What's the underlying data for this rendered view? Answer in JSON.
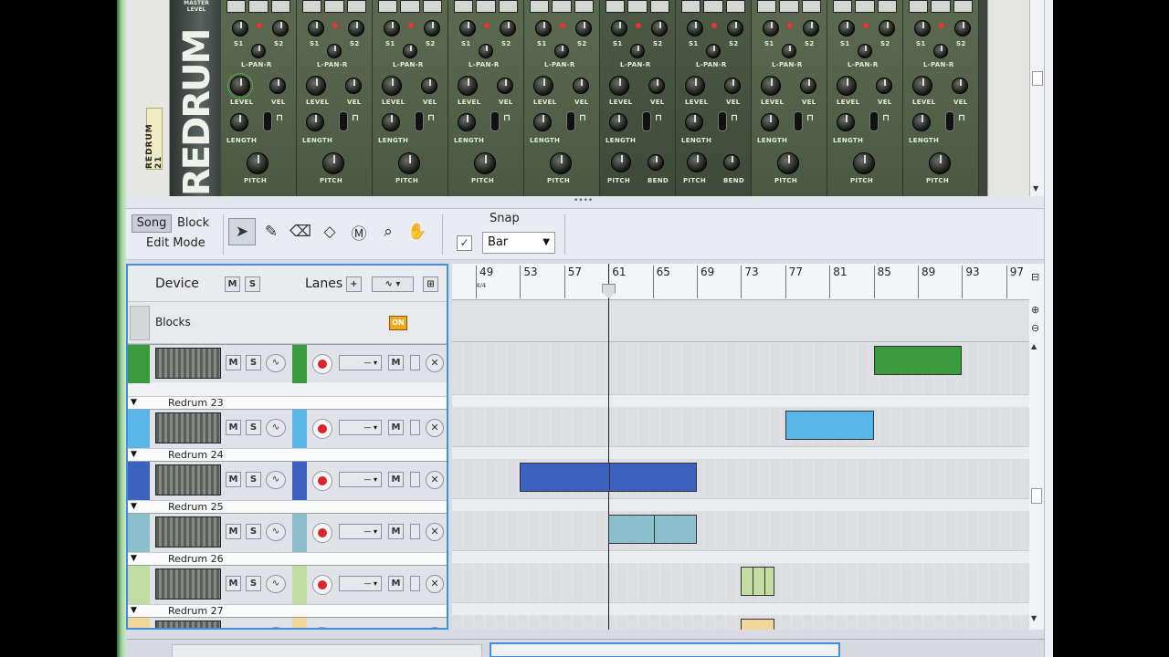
{
  "rack": {
    "device_label": "REDRUM 21",
    "brand_top": "MASTER LEVEL",
    "brand_logo": "REDRUM",
    "channels": [
      {
        "s1": "S1",
        "s2": "S2",
        "pan": "L-PAN-R",
        "level": "LEVEL",
        "vel": "VEL",
        "length": "LENGTH",
        "pitch": "PITCH",
        "bend": "",
        "dark": false
      },
      {
        "s1": "S1",
        "s2": "S2",
        "pan": "L-PAN-R",
        "level": "LEVEL",
        "vel": "VEL",
        "length": "LENGTH",
        "pitch": "PITCH",
        "bend": "",
        "dark": false
      },
      {
        "s1": "S1",
        "s2": "S2",
        "pan": "L-PAN-R",
        "level": "LEVEL",
        "vel": "VEL",
        "length": "LENGTH",
        "pitch": "PITCH",
        "bend": "",
        "dark": false
      },
      {
        "s1": "S1",
        "s2": "S2",
        "pan": "L-PAN-R",
        "level": "LEVEL",
        "vel": "VEL",
        "length": "LENGTH",
        "pitch": "PITCH",
        "bend": "",
        "dark": false
      },
      {
        "s1": "S1",
        "s2": "S2",
        "pan": "L-PAN-R",
        "level": "LEVEL",
        "vel": "VEL",
        "length": "LENGTH",
        "pitch": "PITCH",
        "bend": "",
        "dark": false
      },
      {
        "s1": "S1",
        "s2": "S2",
        "pan": "L-PAN-R",
        "level": "LEVEL",
        "vel": "VEL",
        "length": "LENGTH",
        "pitch": "PITCH",
        "bend": "BEND",
        "dark": true
      },
      {
        "s1": "S1",
        "s2": "S2",
        "pan": "L-PAN-R",
        "level": "LEVEL",
        "vel": "VEL",
        "length": "LENGTH",
        "pitch": "PITCH",
        "bend": "BEND",
        "dark": true
      },
      {
        "s1": "S1",
        "s2": "S2",
        "pan": "L-PAN-R",
        "level": "LEVEL",
        "vel": "VEL",
        "length": "LENGTH",
        "pitch": "PITCH",
        "bend": "",
        "dark": false
      },
      {
        "s1": "S1",
        "s2": "S2",
        "pan": "L-PAN-R",
        "level": "LEVEL",
        "vel": "VEL",
        "length": "LENGTH",
        "pitch": "PITCH",
        "bend": "",
        "dark": false
      },
      {
        "s1": "S1",
        "s2": "S2",
        "pan": "L-PAN-R",
        "level": "LEVEL",
        "vel": "VEL",
        "length": "LENGTH",
        "pitch": "PITCH",
        "bend": "",
        "dark": false
      }
    ]
  },
  "toolbar": {
    "song_label": "Song",
    "block_label": "Block",
    "edit_mode_label": "Edit Mode",
    "snap_label": "Snap",
    "snap_checked": "✓",
    "snap_value": "Bar",
    "tools": [
      "arrow-pointer-icon",
      "pencil-icon",
      "eraser-icon",
      "razor-icon",
      "mute-tool-icon",
      "magnify-icon",
      "hand-icon"
    ]
  },
  "track_list": {
    "device_label": "Device",
    "mute_label": "M",
    "solo_label": "S",
    "lanes_label": "Lanes",
    "add_label": "+",
    "blocks_label": "Blocks",
    "on_label": "ON",
    "tracks": [
      {
        "name": "",
        "color": "#3a9a3e"
      },
      {
        "name": "Redrum 23",
        "color": "#5ab6e8"
      },
      {
        "name": "Redrum 24",
        "color": "#3b62bf"
      },
      {
        "name": "Redrum 25",
        "color": "#8cbfcc"
      },
      {
        "name": "Redrum 26",
        "color": "#c2dca2"
      },
      {
        "name": "Redrum 27",
        "color": "#f3d69a"
      }
    ]
  },
  "ruler": {
    "bars": [
      "49",
      "53",
      "57",
      "61",
      "65",
      "69",
      "73",
      "77",
      "81",
      "85",
      "89",
      "93",
      "97"
    ],
    "time_signature": "4/4",
    "playhead_bar": 61
  },
  "clips": [
    {
      "track": 0,
      "start": 85,
      "end": 93,
      "color": "#3a9a3e",
      "splits": []
    },
    {
      "track": 1,
      "start": 77,
      "end": 85,
      "color": "#5ab6e8",
      "splits": []
    },
    {
      "track": 2,
      "start": 53,
      "end": 69,
      "color": "#3b62bf",
      "splits": [
        61
      ]
    },
    {
      "track": 3,
      "start": 61,
      "end": 69,
      "color": "#8cbfcc",
      "splits": [
        65
      ]
    },
    {
      "track": 4,
      "start": 73,
      "end": 76,
      "color": "#c2dca2",
      "splits": [
        74,
        75
      ]
    },
    {
      "track": 5,
      "start": 73,
      "end": 76,
      "color": "#f3d69a",
      "splits": []
    }
  ]
}
